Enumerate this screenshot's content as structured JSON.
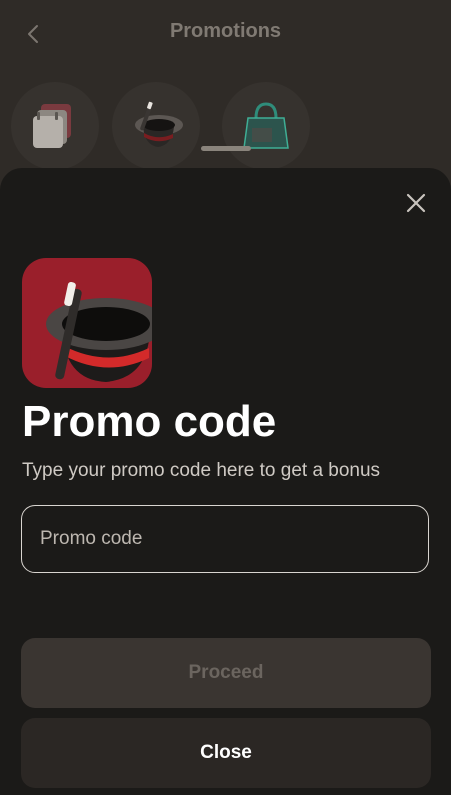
{
  "header": {
    "title": "Promotions",
    "back_icon": "chevron-left-icon"
  },
  "promotions": [
    {
      "icon": "calendar-icon"
    },
    {
      "icon": "magic-hat-icon"
    },
    {
      "icon": "shopping-bag-icon"
    }
  ],
  "modal": {
    "close_icon": "close-icon",
    "promo_icon": "magic-hat-icon",
    "heading": "Promo code",
    "subtitle": "Type your promo code here to get a bonus",
    "input": {
      "placeholder": "Promo code",
      "value": ""
    },
    "proceed_label": "Proceed",
    "close_label": "Close"
  },
  "colors": {
    "background": "#2f2b27",
    "sheet": "#1b1a18",
    "icon_tile": "#9a1f2b",
    "hat_band": "#d32a2a",
    "proceed_disabled_bg": "#3a3531",
    "proceed_disabled_text": "#6b655f"
  }
}
